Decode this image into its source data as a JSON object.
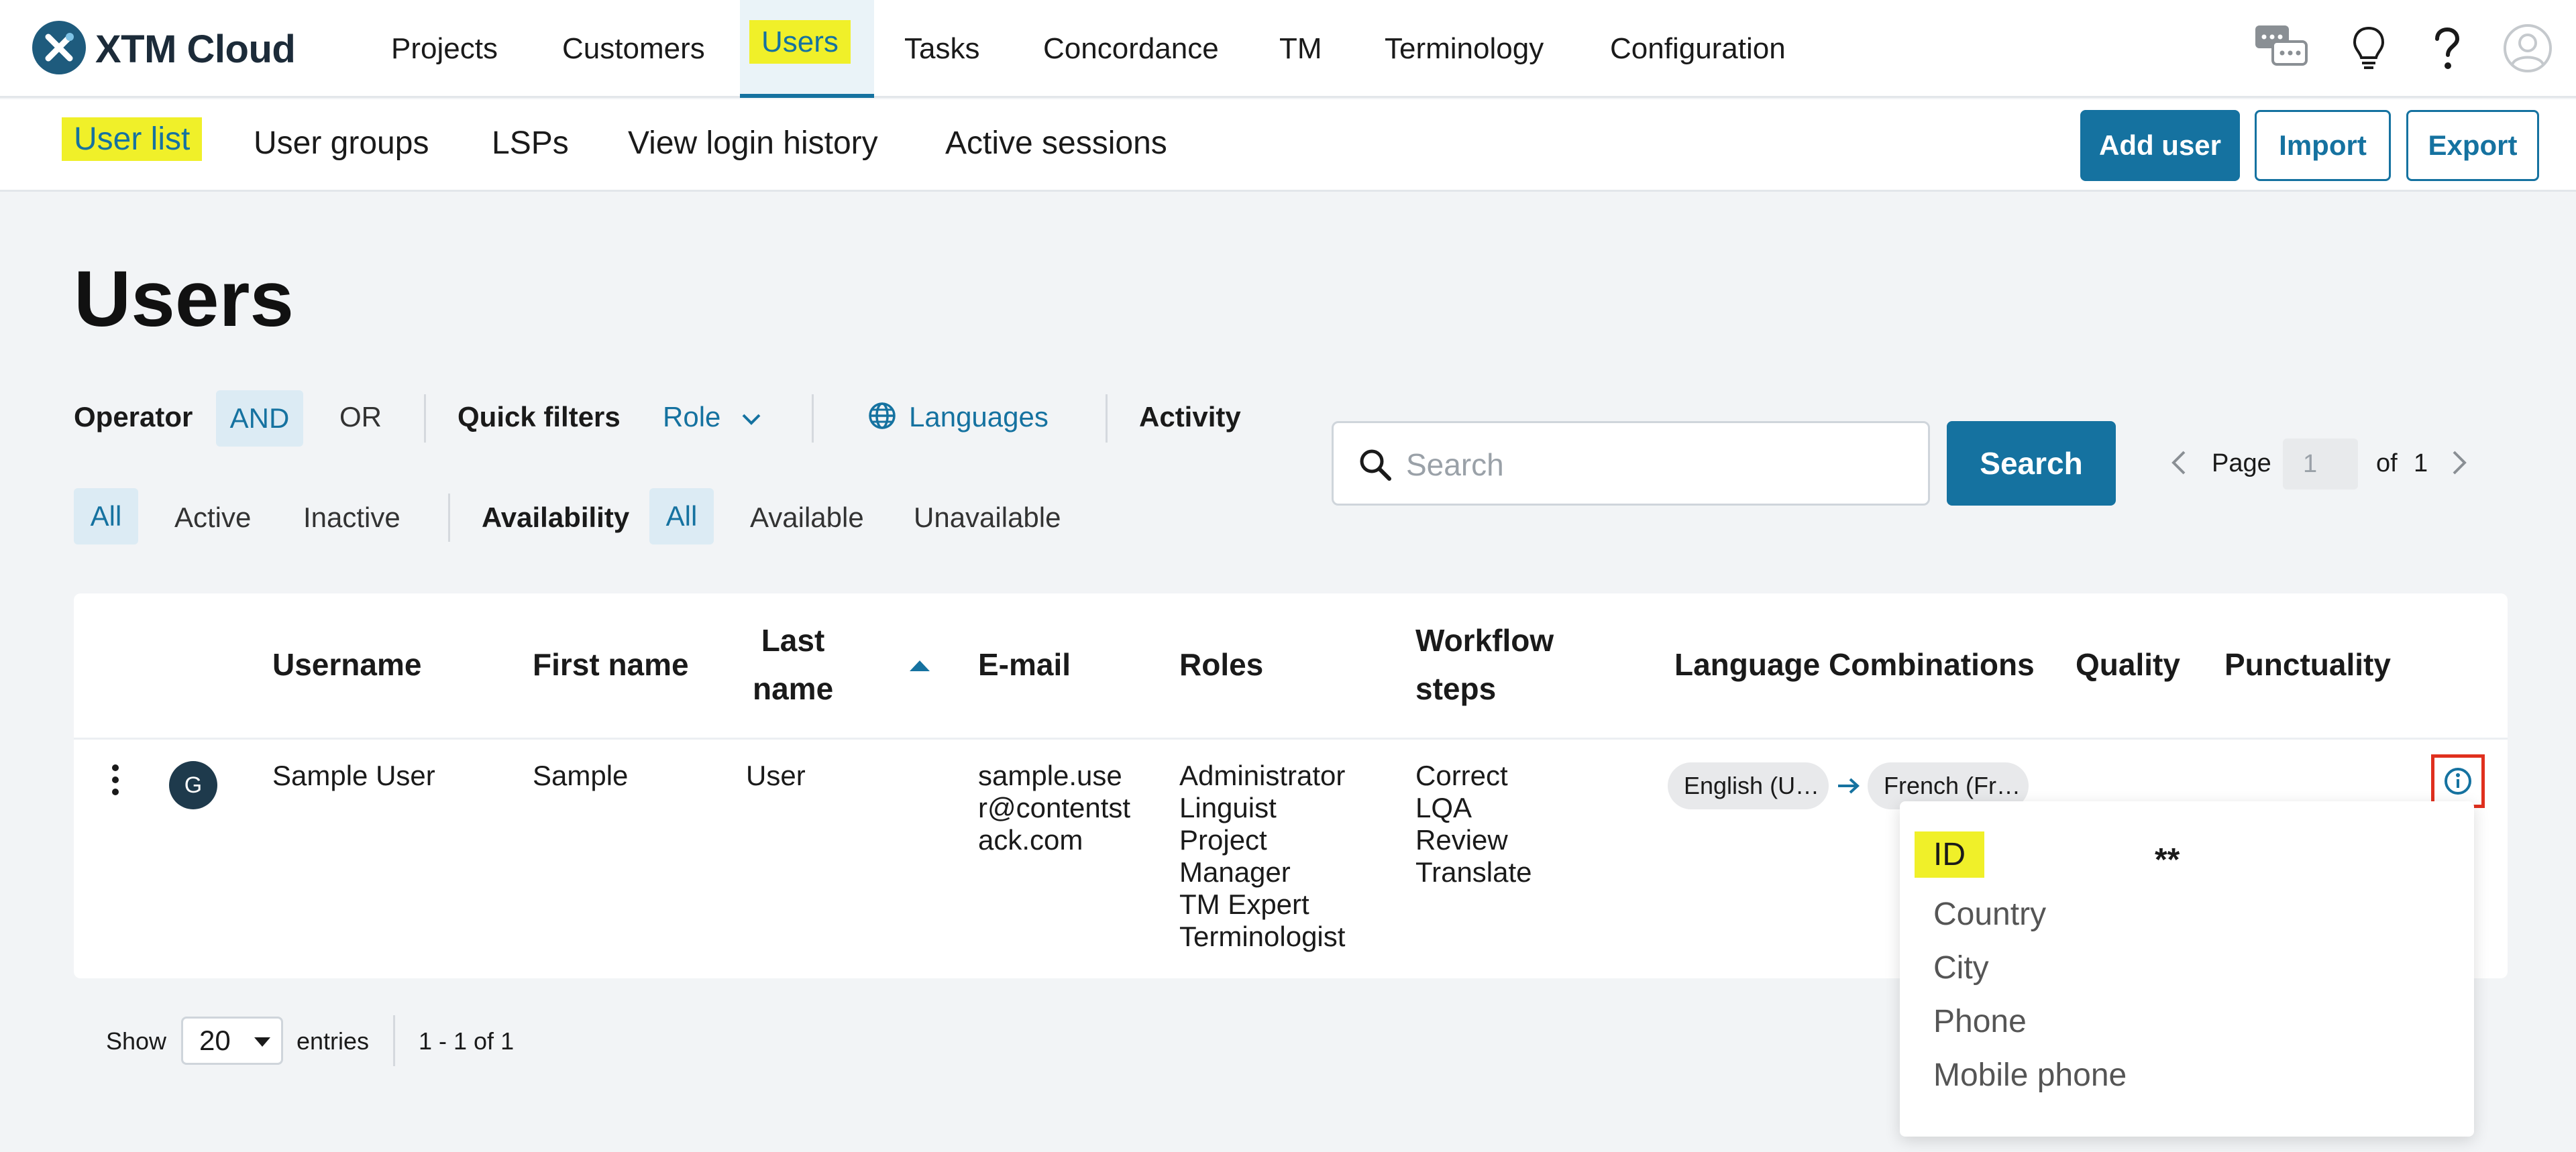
{
  "app": {
    "name": "XTM Cloud"
  },
  "topnav": {
    "items": [
      "Projects",
      "Customers",
      "Users",
      "Tasks",
      "Concordance",
      "TM",
      "Terminology",
      "Configuration"
    ],
    "active": "Users",
    "icons": [
      "chat-icon",
      "lightbulb-icon",
      "help-icon",
      "user-avatar-icon"
    ]
  },
  "subnav": {
    "items": [
      "User list",
      "User groups",
      "LSPs",
      "View login history",
      "Active sessions"
    ],
    "active": "User list",
    "buttons": {
      "add_user": "Add user",
      "import": "Import",
      "export": "Export"
    }
  },
  "page": {
    "title": "Users"
  },
  "filters": {
    "operator_label": "Operator",
    "operator_options": [
      "AND",
      "OR"
    ],
    "operator_selected": "AND",
    "quick_filters_label": "Quick filters",
    "role_label": "Role",
    "languages_label": "Languages",
    "activity_label": "Activity",
    "status_options": [
      "All",
      "Active",
      "Inactive"
    ],
    "status_selected": "All",
    "availability_label": "Availability",
    "availability_options": [
      "All",
      "Available",
      "Unavailable"
    ],
    "availability_selected": "All"
  },
  "search": {
    "placeholder": "Search",
    "button": "Search"
  },
  "pagination": {
    "page_label": "Page",
    "page_value": "1",
    "of_label": "of",
    "total_pages": "1"
  },
  "table": {
    "columns": {
      "username": "Username",
      "first_name": "First name",
      "last_name_1": "Last",
      "last_name_2": "name",
      "email": "E-mail",
      "roles": "Roles",
      "workflow_1": "Workflow",
      "workflow_2": "steps",
      "language_combinations": "Language Combinations",
      "quality": "Quality",
      "punctuality": "Punctuality"
    },
    "sort": {
      "column": "Last name",
      "direction": "ascending"
    },
    "rows": [
      {
        "avatar_letter": "G",
        "username": "Sample User",
        "first_name": "Sample",
        "last_name": "User",
        "email_lines": [
          "sample.use",
          "r@contentst",
          "ack.com"
        ],
        "roles": [
          "Administrator",
          "Linguist",
          "Project",
          "Manager",
          "TM Expert",
          "Terminologist"
        ],
        "workflow_steps": [
          "Correct",
          "LQA",
          "Review",
          "Translate"
        ],
        "language_source": "English (U…",
        "language_target": "French (Fr…"
      }
    ]
  },
  "info_popup": {
    "items": [
      "ID",
      "Country",
      "City",
      "Phone",
      "Mobile phone"
    ],
    "id_value": "**"
  },
  "footer": {
    "show_label": "Show",
    "entries_value": "20",
    "entries_label": "entries",
    "range": "1 - 1 of 1"
  },
  "colors": {
    "accent": "#1572a0",
    "highlight": "#f0f029",
    "annotation_box": "#e0301e"
  }
}
